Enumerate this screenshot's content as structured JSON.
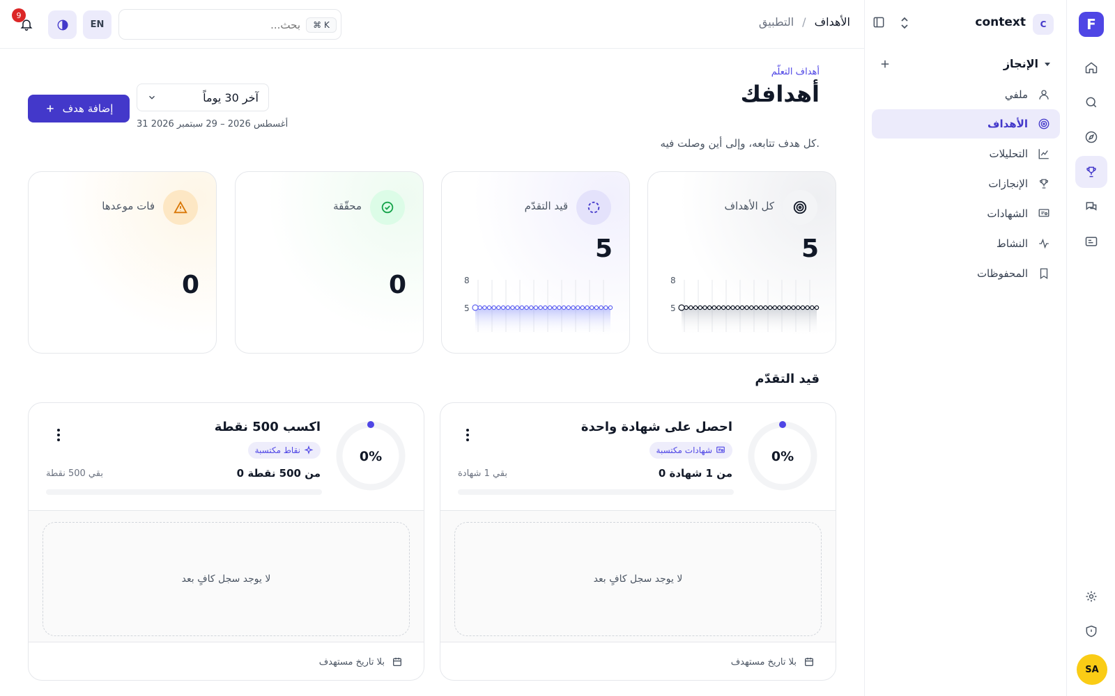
{
  "rail": {
    "logo_letter": "F",
    "items": [
      "home-icon",
      "search-icon",
      "compass-icon",
      "trophy-icon",
      "chat-icon",
      "id-card-icon"
    ],
    "bottom": [
      "gear-icon",
      "shield-icon"
    ],
    "avatar_initials": "SA"
  },
  "sidebar": {
    "workspace_letter": "C",
    "workspace_name": "context",
    "section_title": "الإنجاز",
    "items": [
      {
        "label": "ملفي",
        "icon": "user-icon"
      },
      {
        "label": "الأهداف",
        "icon": "target-icon"
      },
      {
        "label": "التحليلات",
        "icon": "chart-icon"
      },
      {
        "label": "الإنجازات",
        "icon": "trophy-icon"
      },
      {
        "label": "الشهادات",
        "icon": "certificate-icon"
      },
      {
        "label": "النشاط",
        "icon": "activity-icon"
      },
      {
        "label": "المحفوظات",
        "icon": "bookmark-icon"
      }
    ]
  },
  "header": {
    "breadcrumb_root": "التطبيق",
    "breadcrumb_sep": "/",
    "breadcrumb_current": "الأهداف",
    "search_placeholder": "بحث...",
    "search_shortcut": "⌘ K",
    "lang": "EN",
    "notification_count": "9"
  },
  "page": {
    "eyebrow": "أهداف التعلّم",
    "title": "أهدافك",
    "subtitle": "كل هدف تتابعه، وإلى أين وصلت فيه.",
    "add_button": "إضافة هدف",
    "range_select": "آخر 30 يوماً",
    "date_range": "31 أغسطس 2026 – 29 سبتمبر 2026"
  },
  "stats": [
    {
      "label": "كل الأهداف",
      "value": "5",
      "icon": "target-icon",
      "spark_max": "8",
      "spark_val": "5",
      "tint": "#f3f4f6",
      "accent": "#111827"
    },
    {
      "label": "قيد التقدّم",
      "value": "5",
      "icon": "loader-icon",
      "spark_max": "8",
      "spark_val": "5",
      "tint": "#ecebfb",
      "accent": "#6366f1"
    },
    {
      "label": "محقّقة",
      "value": "0",
      "icon": "check-circle-icon",
      "tint": "#dcfce7",
      "accent": "#16a34a"
    },
    {
      "label": "فات موعدها",
      "value": "0",
      "icon": "warning-icon",
      "tint": "#fef3c7",
      "accent": "#d97706"
    }
  ],
  "section_title": "قيد التقدّم",
  "goals": [
    {
      "title": "احصل على شهادة واحدة",
      "percent": "0%",
      "progress": 0,
      "chip": "شهادات مكتسبة",
      "chip_icon": "certificate-icon",
      "count": "0 من 1 شهادة",
      "remaining": "بقي 1 شهادة",
      "empty": "لا يوجد سجل كافٍ بعد",
      "due": "بلا تاريخ مستهدف"
    },
    {
      "title": "اكسب 500 نقطة",
      "percent": "0%",
      "progress": 0,
      "chip": "نقاط مكتسبة",
      "chip_icon": "sparkle-icon",
      "count": "0 من 500 نقطة",
      "remaining": "بقي 500 نقطة",
      "empty": "لا يوجد سجل كافٍ بعد",
      "due": "بلا تاريخ مستهدف"
    }
  ]
}
